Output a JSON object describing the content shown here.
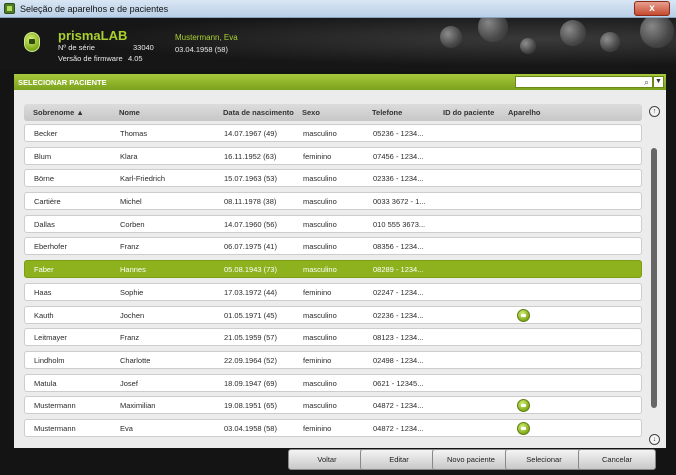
{
  "window": {
    "title": "Seleção de aparelhos e de pacientes",
    "close_label": "x"
  },
  "device": {
    "name": "prismaLAB",
    "serial_label": "Nº de série",
    "serial_value": "33040",
    "firmware_label": "Versão de firmware",
    "firmware_value": "4.05"
  },
  "current_patient": {
    "name": "Mustermann, Eva",
    "dob": "03.04.1958  (58)"
  },
  "section": {
    "title": "SELECIONAR PACIENTE",
    "search_value": "",
    "search_icon": "⌕",
    "dropdown_icon": "▼"
  },
  "table": {
    "columns": [
      "Sobrenome ▲",
      "Nome",
      "Data de nascimento",
      "Sexo",
      "Telefone",
      "ID do paciente",
      "Aparelho"
    ],
    "rows": [
      {
        "last": "Becker",
        "first": "Thomas",
        "dob": "14.07.1967  (49)",
        "sex": "masculino",
        "phone": "05236 - 1234...",
        "id": "",
        "device": false
      },
      {
        "last": "Blum",
        "first": "Klara",
        "dob": "16.11.1952  (63)",
        "sex": "feminino",
        "phone": "07456 - 1234...",
        "id": "",
        "device": false
      },
      {
        "last": "Börne",
        "first": "Karl-Friedrich",
        "dob": "15.07.1963  (53)",
        "sex": "masculino",
        "phone": "02336 - 1234...",
        "id": "",
        "device": false
      },
      {
        "last": "Cartière",
        "first": "Michel",
        "dob": "08.11.1978  (38)",
        "sex": "masculino",
        "phone": "0033 3672 - 1...",
        "id": "",
        "device": false
      },
      {
        "last": "Dallas",
        "first": "Corben",
        "dob": "14.07.1960  (56)",
        "sex": "masculino",
        "phone": "010 555 3673...",
        "id": "",
        "device": false
      },
      {
        "last": "Eberhofer",
        "first": "Franz",
        "dob": "06.07.1975  (41)",
        "sex": "masculino",
        "phone": "08356 - 1234...",
        "id": "",
        "device": false
      },
      {
        "last": "Faber",
        "first": "Hannes",
        "dob": "05.08.1943  (73)",
        "sex": "masculino",
        "phone": "08289 - 1234...",
        "id": "",
        "device": false,
        "selected": true
      },
      {
        "last": "Haas",
        "first": "Sophie",
        "dob": "17.03.1972  (44)",
        "sex": "feminino",
        "phone": "02247 - 1234...",
        "id": "",
        "device": false
      },
      {
        "last": "Kauth",
        "first": "Jochen",
        "dob": "01.05.1971  (45)",
        "sex": "masculino",
        "phone": "02236 - 1234...",
        "id": "",
        "device": true
      },
      {
        "last": "Leitmayer",
        "first": "Franz",
        "dob": "21.05.1959  (57)",
        "sex": "masculino",
        "phone": "08123 - 1234...",
        "id": "",
        "device": false
      },
      {
        "last": "Lindholm",
        "first": "Charlotte",
        "dob": "22.09.1964  (52)",
        "sex": "feminino",
        "phone": "02498 - 1234...",
        "id": "",
        "device": false
      },
      {
        "last": "Matula",
        "first": "Josef",
        "dob": "18.09.1947  (69)",
        "sex": "masculino",
        "phone": "0621 - 12345...",
        "id": "",
        "device": false
      },
      {
        "last": "Mustermann",
        "first": "Maximilian",
        "dob": "19.08.1951  (65)",
        "sex": "masculino",
        "phone": "04872 - 1234...",
        "id": "",
        "device": true
      },
      {
        "last": "Mustermann",
        "first": "Eva",
        "dob": "03.04.1958  (58)",
        "sex": "feminino",
        "phone": "04872 - 1234...",
        "id": "",
        "device": true
      }
    ]
  },
  "scroll": {
    "up_icon": "↑",
    "down_icon": "↓"
  },
  "buttons": {
    "back": "Voltar",
    "edit": "Editar",
    "new_patient": "Novo paciente",
    "select": "Selecionar",
    "cancel": "Cancelar"
  }
}
